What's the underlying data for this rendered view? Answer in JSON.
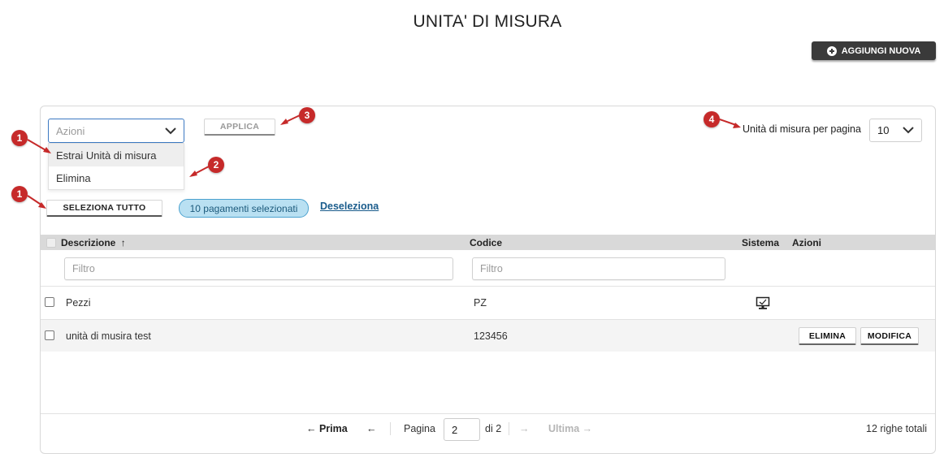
{
  "page_title": "UNITA' DI MISURA",
  "add_button": {
    "label": "AGGIUNGI NUOVA",
    "icon": "plus-circle-icon"
  },
  "actions_select": {
    "placeholder": "Azioni",
    "options": [
      "Estrai Unità di misura",
      "Elimina"
    ]
  },
  "apply_button": "APPLICA",
  "select_all_button": "SELEZIONA TUTTO",
  "selected_badge": "10 pagamenti selezionati",
  "deselect_link": "Deseleziona",
  "per_page": {
    "label": "Unità di misura per pagina",
    "value": "10"
  },
  "table": {
    "columns": {
      "descrizione": "Descrizione",
      "codice": "Codice",
      "sistema": "Sistema",
      "azioni": "Azioni"
    },
    "sort_indicator": "↑",
    "filter_placeholder": "Filtro",
    "rows": [
      {
        "descrizione": "Pezzi",
        "codice": "PZ",
        "sistema": true,
        "actions": []
      },
      {
        "descrizione": "unità di musira test",
        "codice": "123456",
        "sistema": false,
        "actions": [
          "ELIMINA",
          "MODIFICA"
        ]
      }
    ]
  },
  "pagination": {
    "first": "← Prima",
    "prev": "←",
    "page_label": "Pagina",
    "current": "2",
    "of_total": "di 2",
    "next": "→",
    "last": "Ultima →",
    "total_rows": "12 righe totali"
  },
  "annotations": [
    "1",
    "2",
    "3",
    "4",
    "1"
  ],
  "colors": {
    "marker": "#c62a2a",
    "badge_bg": "#b9e0f2",
    "link": "#1a5c8c",
    "header_bg": "#d9d9d9",
    "dark_button": "#3a3a3a"
  }
}
